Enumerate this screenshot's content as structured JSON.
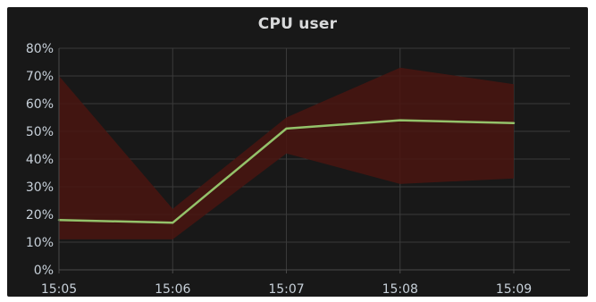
{
  "panel": {
    "title": "CPU user"
  },
  "chart_data": {
    "type": "line",
    "title": "CPU user",
    "xlabel": "",
    "ylabel": "",
    "x": [
      "15:05",
      "15:06",
      "15:07",
      "15:08",
      "15:09"
    ],
    "x_ticks": [
      "15:05",
      "15:06",
      "15:07",
      "15:08",
      "15:09"
    ],
    "y_ticks": [
      "0%",
      "10%",
      "20%",
      "30%",
      "40%",
      "50%",
      "60%",
      "70%",
      "80%"
    ],
    "ylim": [
      0,
      80
    ],
    "y_unit": "%",
    "grid": true,
    "legend": "none",
    "series": [
      {
        "values": [
          18,
          17,
          51,
          54,
          53
        ],
        "band_upper": [
          70,
          22,
          55,
          73,
          67
        ],
        "band_lower": [
          11,
          11,
          42,
          31,
          33
        ],
        "line_color": "#94c26a",
        "band_color": "#4a1510"
      }
    ]
  },
  "colors": {
    "background": "#181818",
    "grid": "#3a3a3a",
    "axis": "#4a4a4a",
    "text": "#c7d0d9",
    "title": "#d8d9da"
  }
}
